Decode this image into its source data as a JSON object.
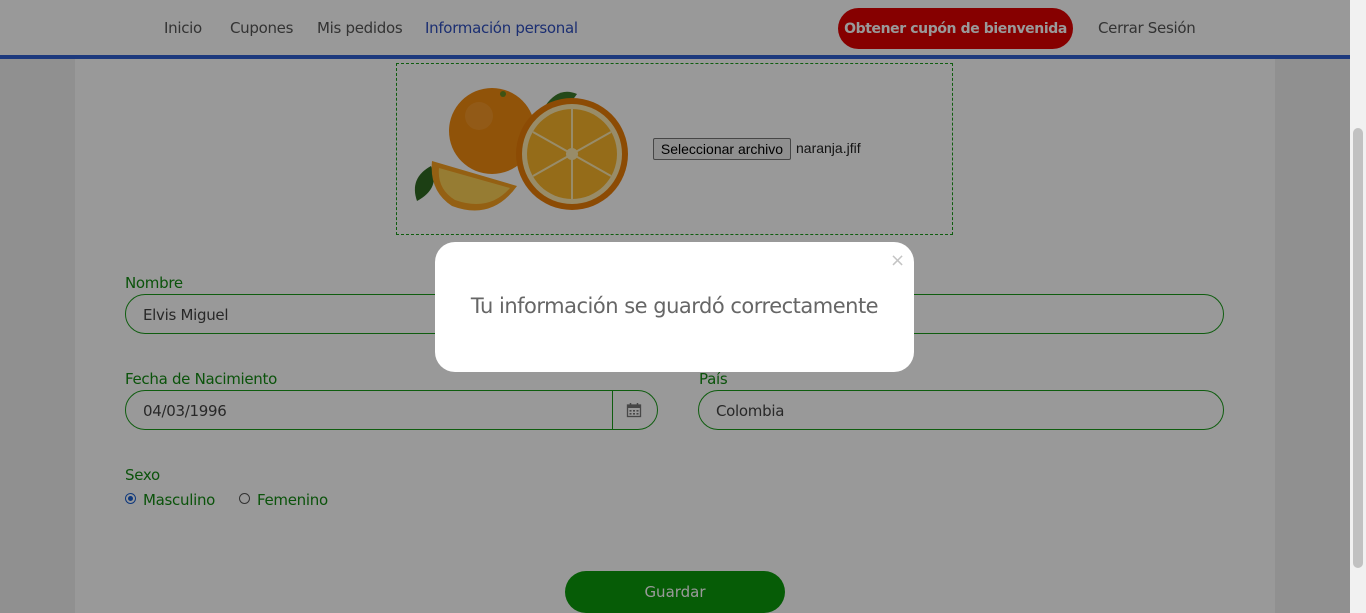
{
  "nav": {
    "links": [
      "Inicio",
      "Cupones",
      "Mis pedidos",
      "Información personal"
    ],
    "active_link": "Información personal",
    "welcome_coupon_button": "Obtener cupón de bienvenida",
    "logout": "Cerrar Sesión"
  },
  "profile_image": {
    "select_file_button": "Seleccionar archivo",
    "file_name": "naranja.jfif"
  },
  "form": {
    "nombre": {
      "label": "Nombre",
      "value": "Elvis Miguel"
    },
    "fecha": {
      "label": "Fecha de Nacimiento",
      "value": "04/03/1996"
    },
    "pais": {
      "label": "País",
      "value": "Colombia"
    },
    "sexo": {
      "label": "Sexo",
      "options": [
        "Masculino",
        "Femenino"
      ],
      "selected": "Masculino"
    },
    "save_button": "Guardar"
  },
  "modal": {
    "message": "Tu información se guardó correctamente",
    "close_symbol": "×"
  },
  "colors": {
    "brand_green": "#0a9a0a",
    "coupon_red": "#e00000",
    "nav_accent_blue": "#2f5fd0"
  }
}
